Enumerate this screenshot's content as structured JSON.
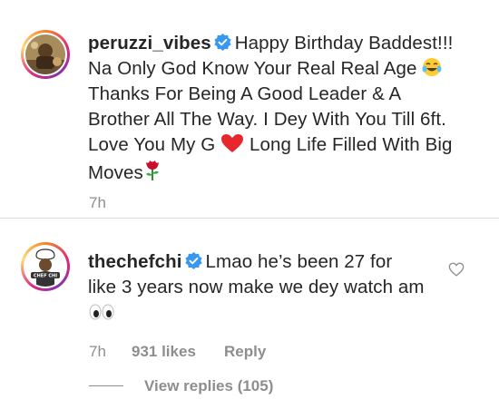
{
  "comments": [
    {
      "username": "peruzzi_vibes",
      "lines": [
        "Happy Birthday Baddest!!!",
        "Na Only God Know Your Real Real Age",
        "Thanks For Being A Good Leader & A",
        "Brother All The Way. I Dey With You Till 6ft.",
        "Love You My G",
        "Long Life Filled With Big",
        "Moves"
      ],
      "time": "7h"
    },
    {
      "username": "thechefchi",
      "lines": [
        "Lmao he’s been 27 for",
        "like 3 years now make we dey watch am"
      ],
      "time": "7h",
      "likes": "931 likes",
      "reply": "Reply",
      "view_replies": "View replies (105)",
      "avatar_text": "CHEF CHI"
    }
  ],
  "icons": {
    "verified": "verified-badge-icon",
    "laugh": "tears-of-joy-emoji",
    "heart": "red-heart-emoji",
    "rose": "rose-emoji",
    "eyes": "eyes-emoji",
    "like": "heart-outline-icon"
  },
  "colors": {
    "verified": "#3897f0",
    "muted": "#8e8e8e",
    "text": "#262626"
  }
}
